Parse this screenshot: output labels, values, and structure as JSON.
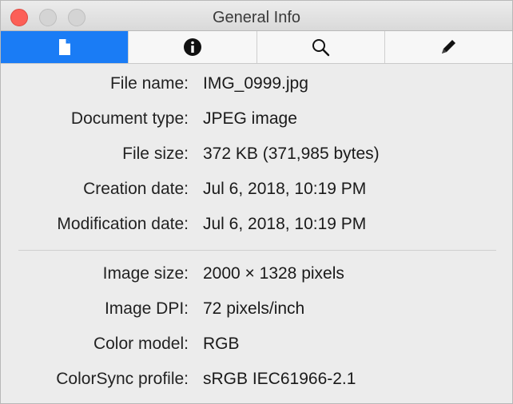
{
  "window": {
    "title": "General Info"
  },
  "tabs": [
    {
      "icon": "document-icon",
      "active": true
    },
    {
      "icon": "info-icon",
      "active": false
    },
    {
      "icon": "search-icon",
      "active": false
    },
    {
      "icon": "pencil-icon",
      "active": false
    }
  ],
  "info": {
    "file_name": {
      "label": "File name:",
      "value": "IMG_0999.jpg"
    },
    "document_type": {
      "label": "Document type:",
      "value": "JPEG image"
    },
    "file_size": {
      "label": "File size:",
      "value": "372 KB (371,985 bytes)"
    },
    "creation_date": {
      "label": "Creation date:",
      "value": "Jul 6, 2018, 10:19 PM"
    },
    "modification_date": {
      "label": "Modification date:",
      "value": "Jul 6, 2018, 10:19 PM"
    },
    "image_size": {
      "label": "Image size:",
      "value": "2000 × 1328 pixels"
    },
    "image_dpi": {
      "label": "Image DPI:",
      "value": "72 pixels/inch"
    },
    "color_model": {
      "label": "Color model:",
      "value": "RGB"
    },
    "colorsync_profile": {
      "label": "ColorSync profile:",
      "value": "sRGB IEC61966-2.1"
    }
  },
  "colors": {
    "accent": "#1a7cf5",
    "close": "#fc5f57"
  }
}
